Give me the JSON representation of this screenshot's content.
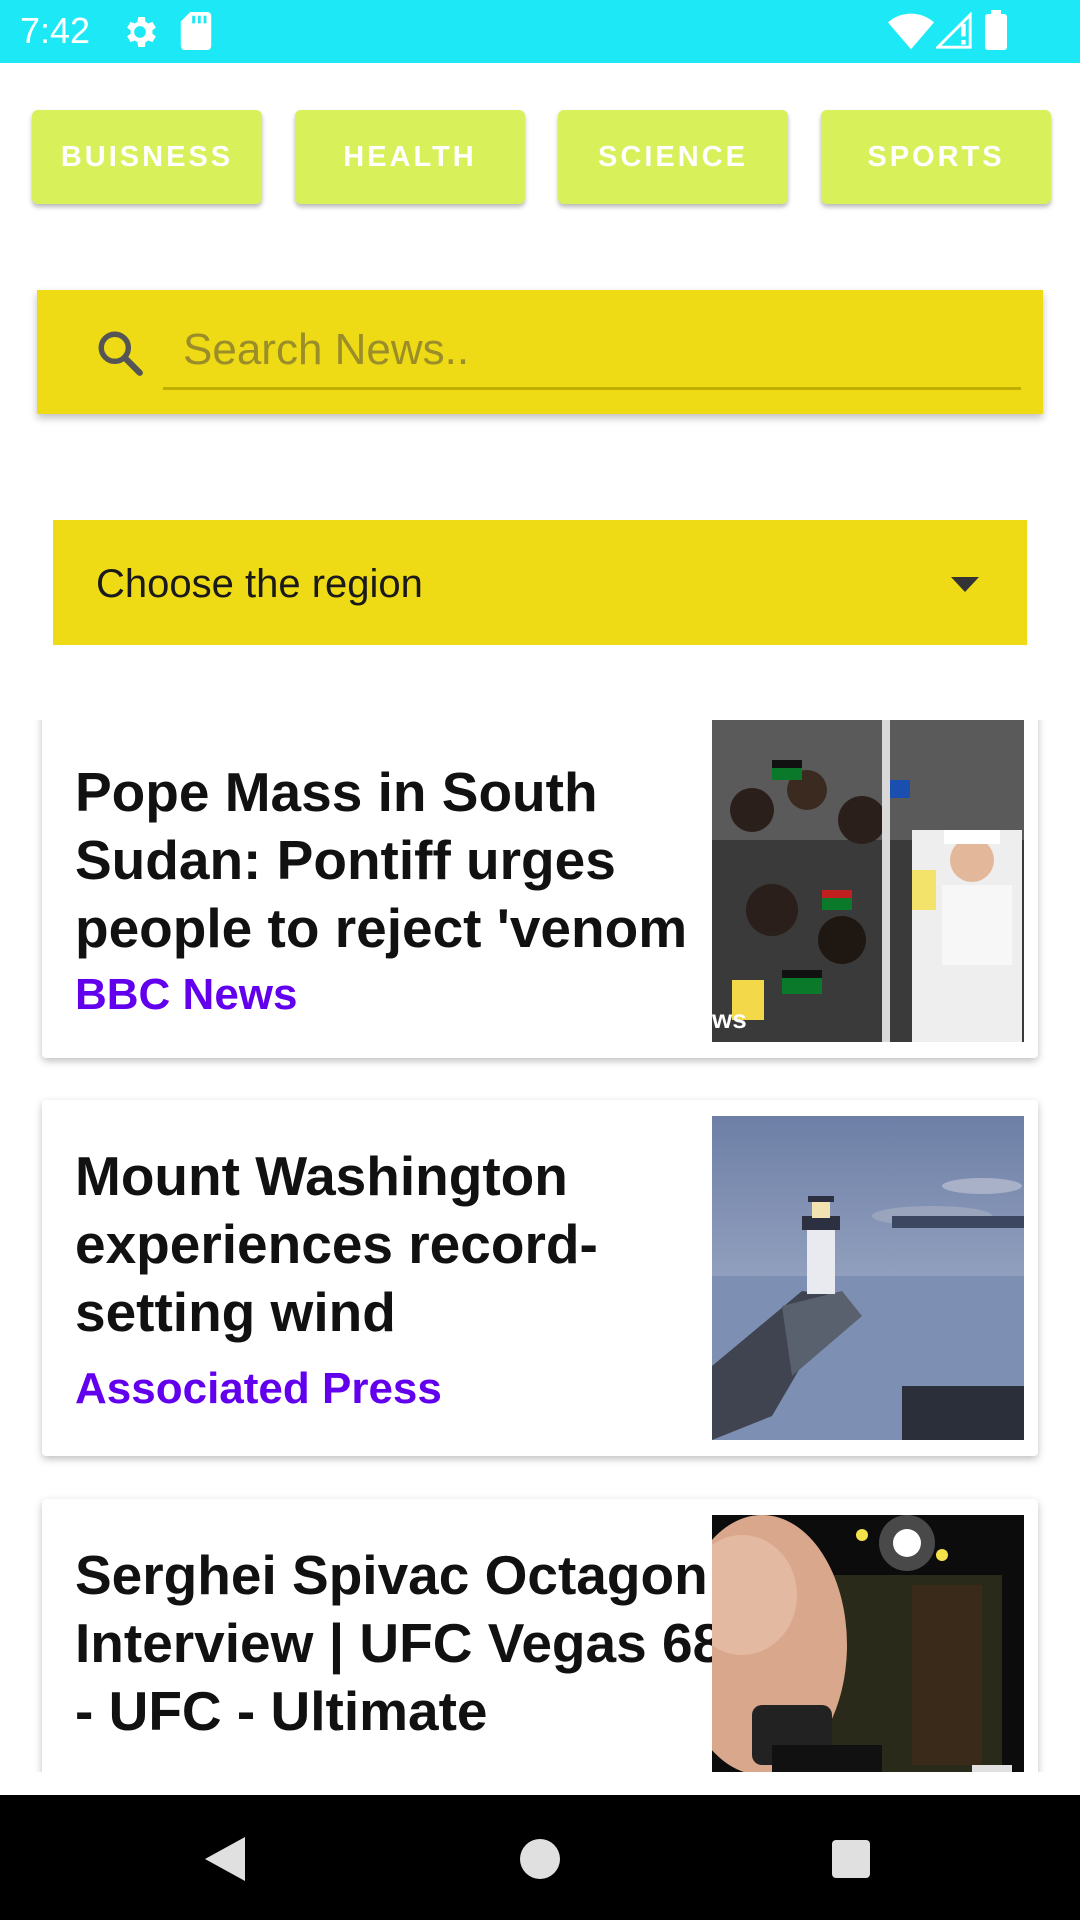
{
  "status_bar": {
    "time": "7:42",
    "icons": [
      "gear-icon",
      "sd-card-icon",
      "wifi-icon",
      "signal-icon",
      "battery-icon"
    ]
  },
  "categories": [
    {
      "label": "BUISNESS"
    },
    {
      "label": "HEALTH"
    },
    {
      "label": "SCIENCE"
    },
    {
      "label": "SPORTS"
    }
  ],
  "search": {
    "placeholder": "Search News.."
  },
  "region": {
    "label": "Choose the region"
  },
  "articles": [
    {
      "title": "Pope Mass in South Sudan: Pontiff urges people to reject 'venom",
      "source": "BBC News",
      "image_overlay": "ws"
    },
    {
      "title": "Mount Washington experiences record-setting wind",
      "source": "Associated Press"
    },
    {
      "title": "Serghei Spivac Octagon Interview | UFC Vegas 68 - UFC - Ultimate",
      "source": ""
    }
  ],
  "colors": {
    "status_bar": "#1de9f6",
    "chip": "#d8f05a",
    "search_bg": "#eedb16",
    "source_text": "#6200ee"
  }
}
